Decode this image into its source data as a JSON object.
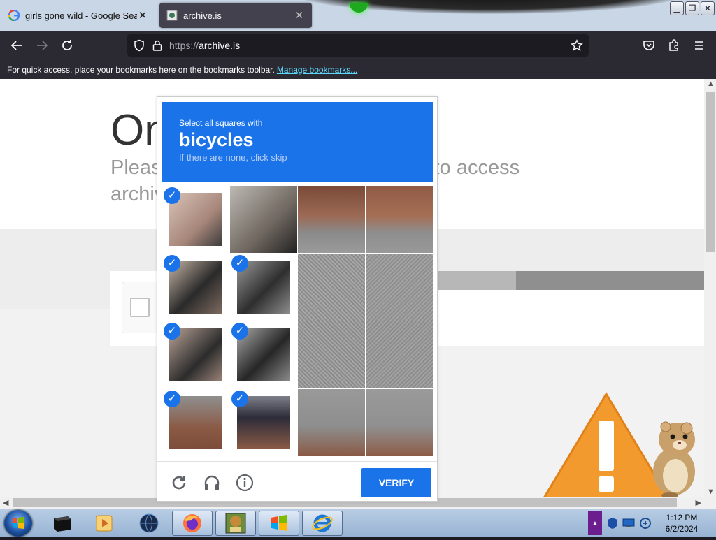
{
  "browser": {
    "tabs": [
      {
        "title": "girls gone wild - Google Search",
        "favicon": "google-g-icon",
        "active": false
      },
      {
        "title": "archive.is",
        "favicon": "archive-favicon",
        "active": true
      }
    ],
    "url_scheme": "https://",
    "url_host": "archive.is",
    "bookmarks_message": "For quick access, place your bookmarks here on the bookmarks toolbar.",
    "bookmarks_link": "Manage bookmarks..."
  },
  "page": {
    "heading": "One",
    "subtitle": "Please complete the security check to access archive.is"
  },
  "captcha": {
    "instruction": "Select all squares with",
    "target": "bicycles",
    "hint": "If there are none, click skip",
    "verify_label": "VERIFY",
    "selected": [
      true,
      false,
      false,
      false,
      true,
      true,
      false,
      false,
      true,
      true,
      false,
      false,
      true,
      true,
      false,
      false
    ],
    "accent": "#1a73e8"
  },
  "taskbar": {
    "time": "1:12 PM",
    "date": "6/2/2024"
  }
}
